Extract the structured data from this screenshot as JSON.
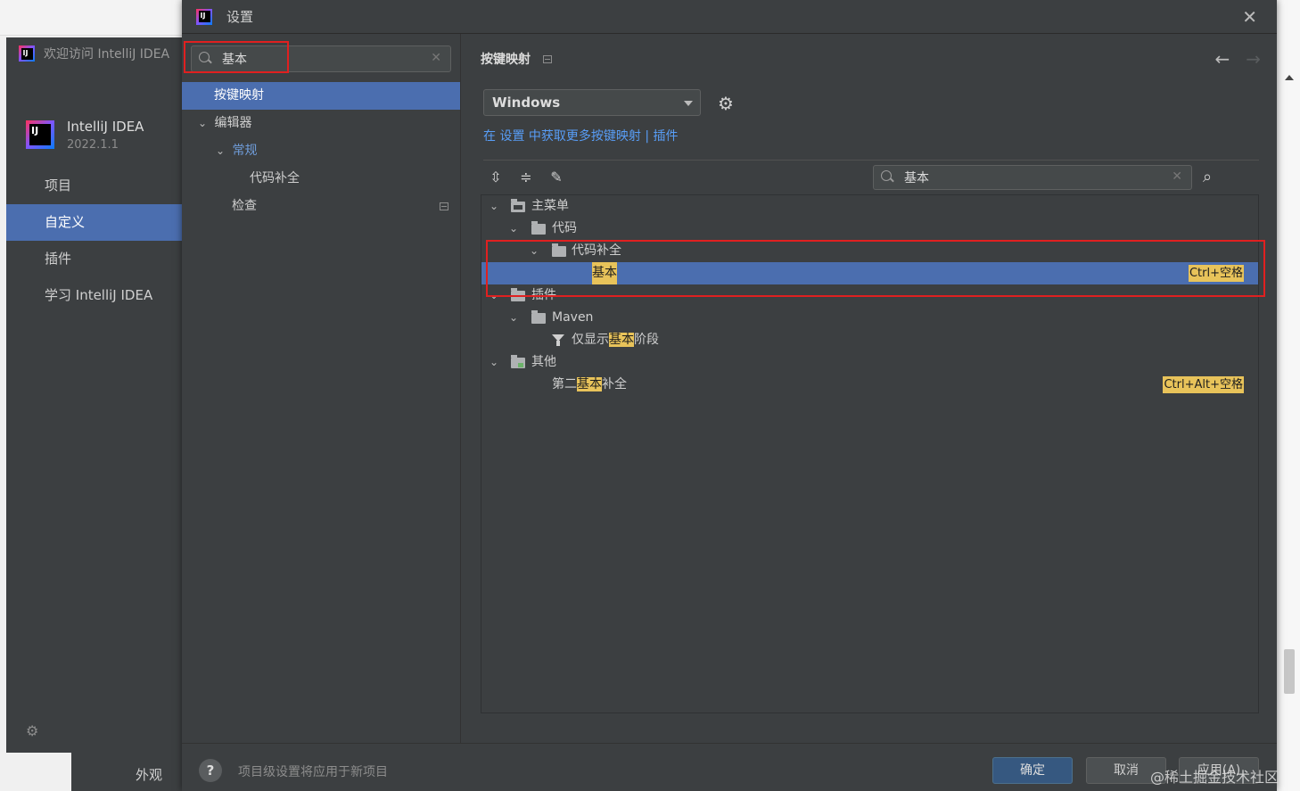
{
  "welcome": {
    "title": "欢迎访问 IntelliJ IDEA",
    "product_name": "IntelliJ IDEA",
    "version": "2022.1.1",
    "nav": [
      {
        "label": "项目",
        "active": false
      },
      {
        "label": "自定义",
        "active": true
      },
      {
        "label": "插件",
        "active": false
      },
      {
        "label": "学习 IntelliJ IDEA",
        "active": false
      }
    ],
    "behind_label": "外观"
  },
  "dialog": {
    "title": "设置",
    "close_glyph": "✕",
    "left": {
      "search_value": "基本",
      "tree": [
        {
          "label": "按键映射",
          "level": 0,
          "selected": true,
          "expander": ""
        },
        {
          "label": "编辑器",
          "level": 0,
          "selected": false,
          "expander": "⌄"
        },
        {
          "label": "常规",
          "level": 1,
          "selected": false,
          "expander": "⌄",
          "accent": true
        },
        {
          "label": "代码补全",
          "level": 2,
          "selected": false,
          "expander": ""
        },
        {
          "label": "检查",
          "level": 1,
          "selected": false,
          "expander": ""
        }
      ]
    },
    "right": {
      "page_title": "按键映射",
      "keymap": "Windows",
      "link_text": "在 设置 中获取更多按键映射 | 插件",
      "filter_value": "基本",
      "tree": {
        "main_menu": "主菜单",
        "code": "代码",
        "code_completion": "代码补全",
        "basic": "基本",
        "basic_shortcut": "Ctrl+空格",
        "plugins": "插件",
        "maven": "Maven",
        "maven_filter": {
          "pre": "仅显示",
          "hl": "基本",
          "post": "阶段"
        },
        "other": "其他",
        "second_basic": {
          "pre": "第二",
          "hl": "基本",
          "post": "补全"
        },
        "second_basic_shortcut": "Ctrl+Alt+空格"
      }
    },
    "bottom": {
      "help": "?",
      "note": "项目级设置将应用于新项目",
      "ok": "确定",
      "cancel": "取消",
      "apply": "应用(A)"
    }
  },
  "watermark": "@稀土掘金技术社区",
  "colors": {
    "selection": "#4b6eaf",
    "highlight": "#e8c35a",
    "link": "#589df6",
    "annotation_box": "#e02020"
  }
}
